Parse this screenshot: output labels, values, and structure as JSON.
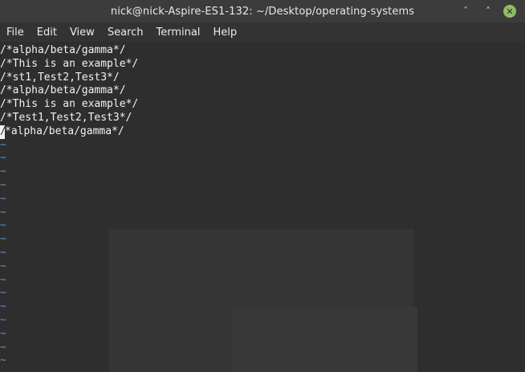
{
  "window": {
    "title": "nick@nick-Aspire-ES1-132: ~/Desktop/operating-systems",
    "minimize_glyph": "ˇ",
    "maximize_glyph": "˄",
    "close_glyph": "✕"
  },
  "menu": [
    "File",
    "Edit",
    "View",
    "Search",
    "Terminal",
    "Help"
  ],
  "terminal": {
    "lines": [
      "/*alpha/beta/gamma*/",
      "/*This is an example*/",
      "/*st1,Test2,Test3*/",
      "/*alpha/beta/gamma*/",
      "/*This is an example*/",
      "/*Test1,Test2,Test3*/"
    ],
    "cursor_line_rest": "*alpha/beta/gamma*/",
    "cursor_char": "/",
    "empty_line_marker": "~",
    "empty_line_count": 17
  }
}
